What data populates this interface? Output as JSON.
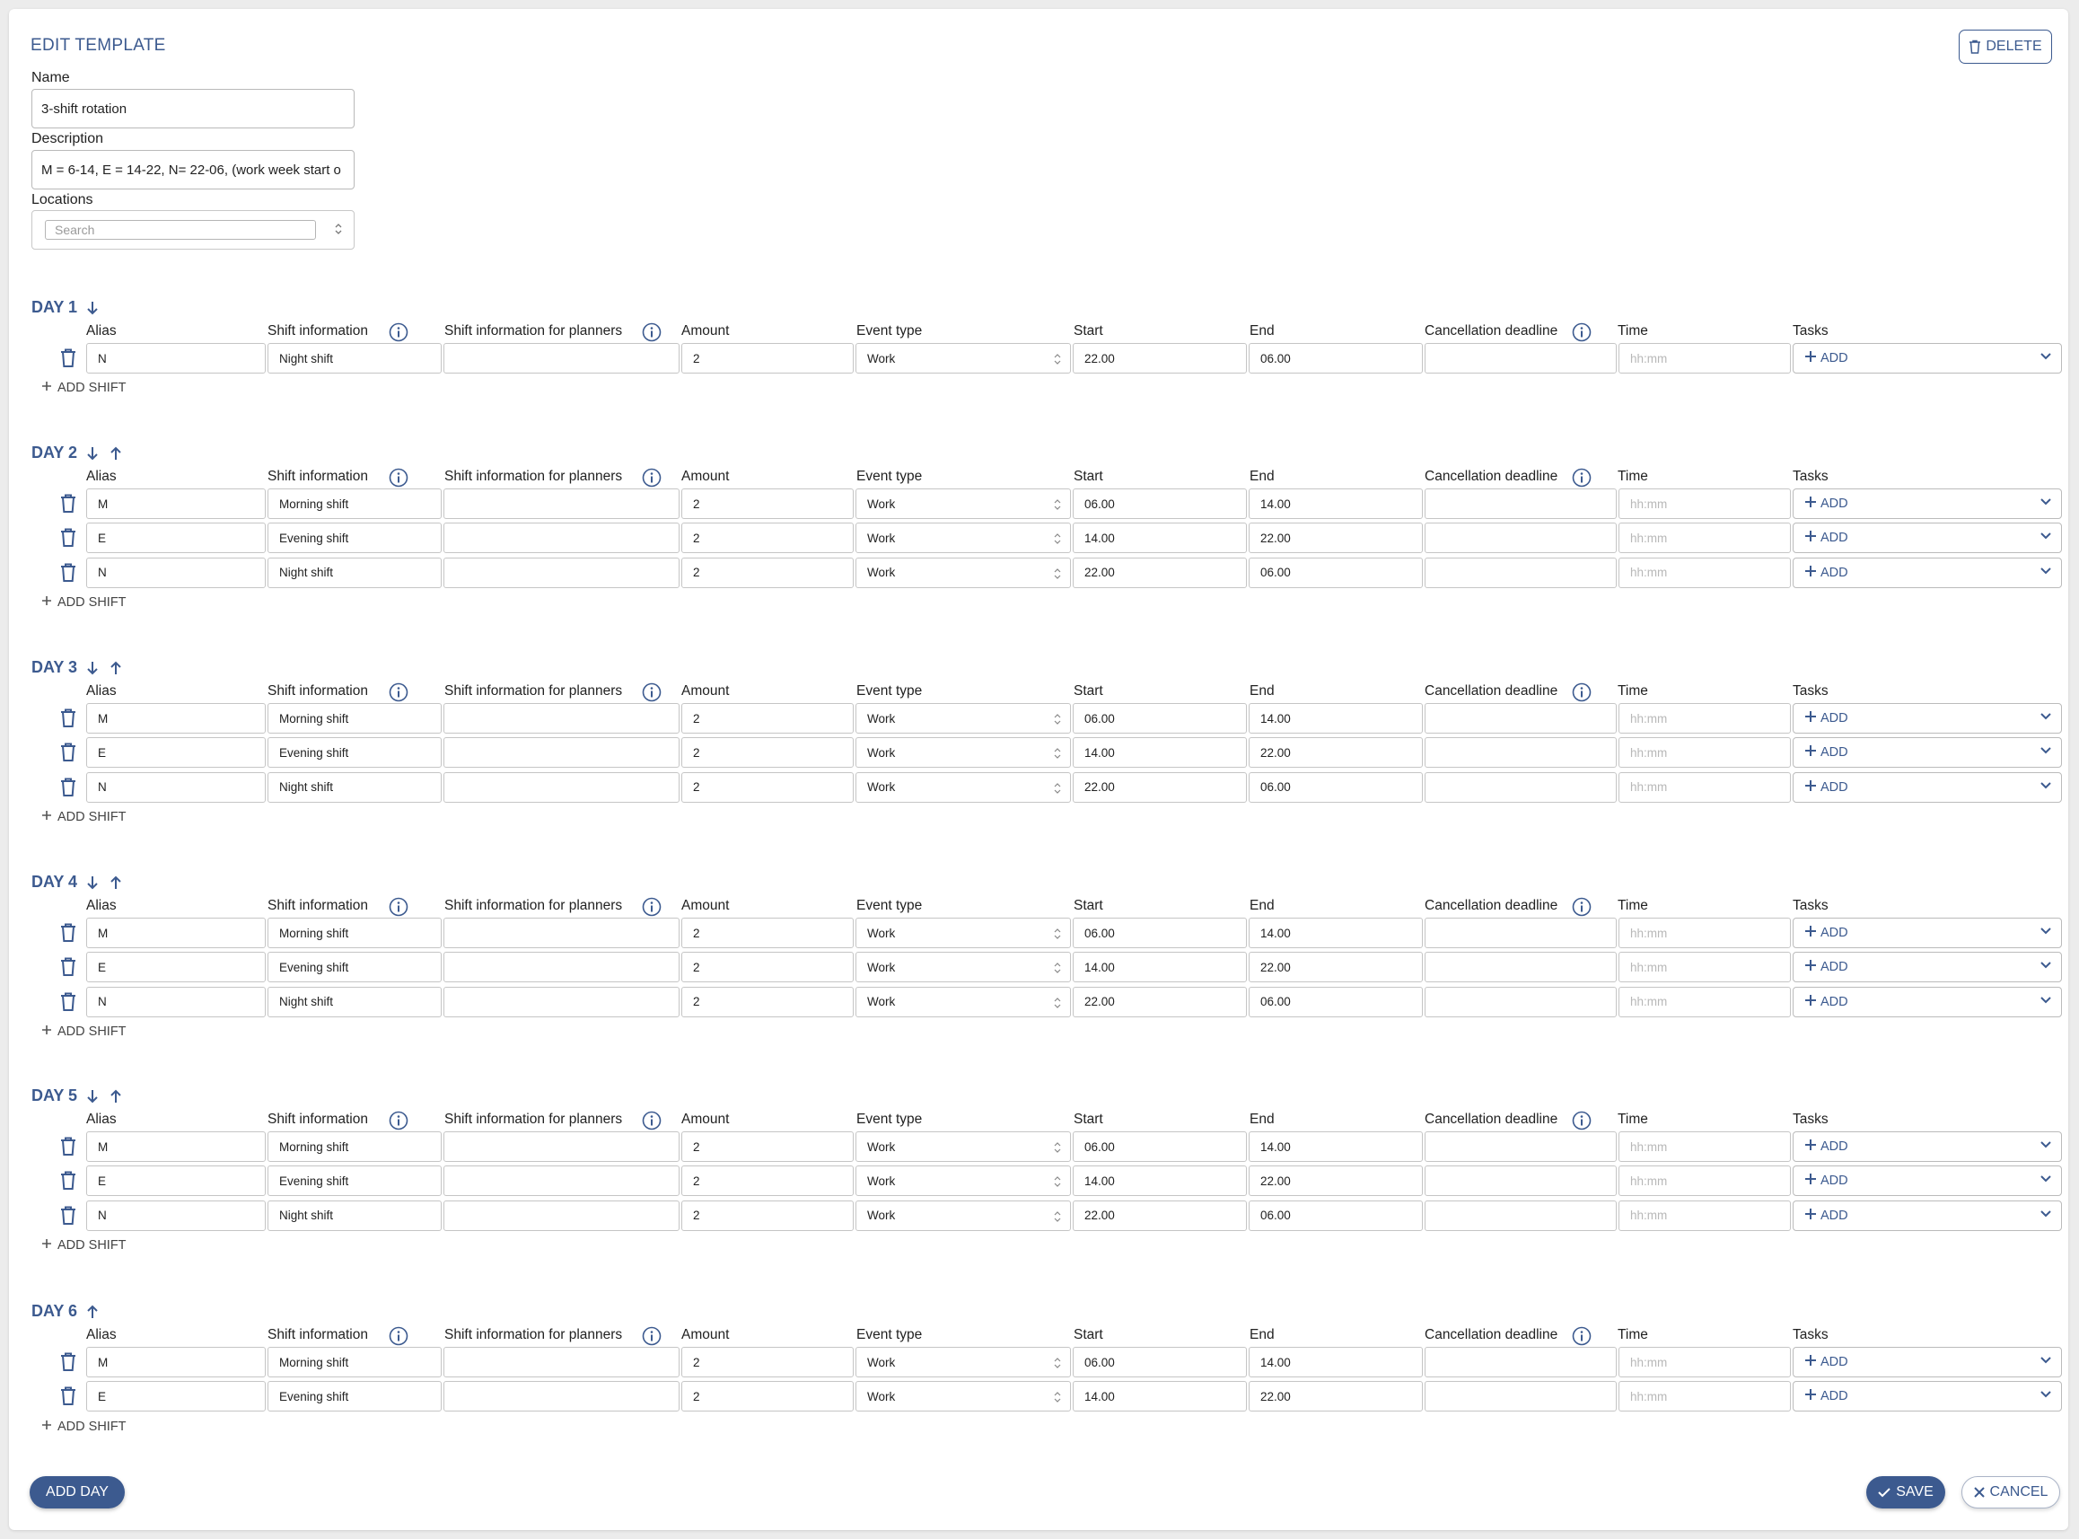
{
  "header": {
    "title": "EDIT TEMPLATE",
    "delete_label": "DELETE"
  },
  "form": {
    "name_label": "Name",
    "name_value": "3-shift rotation",
    "description_label": "Description",
    "description_value": "M = 6-14, E = 14-22, N= 22-06, (work week start o",
    "locations_label": "Locations",
    "locations_placeholder": "Search"
  },
  "columns": {
    "alias": "Alias",
    "shift_info": "Shift information",
    "shift_info_planners": "Shift information for planners",
    "amount": "Amount",
    "event_type": "Event type",
    "start": "Start",
    "end": "End",
    "cancellation": "Cancellation deadline",
    "time": "Time",
    "tasks": "Tasks"
  },
  "time_placeholder": "hh:mm",
  "tasks_add_label": "ADD",
  "add_shift_label": "ADD SHIFT",
  "days": [
    {
      "label": "DAY 1",
      "down": true,
      "up": false,
      "shifts": [
        {
          "alias": "N",
          "info": "Night shift",
          "planners": "",
          "amount": "2",
          "event_type": "Work",
          "start": "22.00",
          "end": "06.00",
          "cancellation": ""
        }
      ]
    },
    {
      "label": "DAY 2",
      "down": true,
      "up": true,
      "shifts": [
        {
          "alias": "M",
          "info": "Morning shift",
          "planners": "",
          "amount": "2",
          "event_type": "Work",
          "start": "06.00",
          "end": "14.00",
          "cancellation": ""
        },
        {
          "alias": "E",
          "info": "Evening shift",
          "planners": "",
          "amount": "2",
          "event_type": "Work",
          "start": "14.00",
          "end": "22.00",
          "cancellation": ""
        },
        {
          "alias": "N",
          "info": "Night shift",
          "planners": "",
          "amount": "2",
          "event_type": "Work",
          "start": "22.00",
          "end": "06.00",
          "cancellation": ""
        }
      ]
    },
    {
      "label": "DAY 3",
      "down": true,
      "up": true,
      "shifts": [
        {
          "alias": "M",
          "info": "Morning shift",
          "planners": "",
          "amount": "2",
          "event_type": "Work",
          "start": "06.00",
          "end": "14.00",
          "cancellation": ""
        },
        {
          "alias": "E",
          "info": "Evening shift",
          "planners": "",
          "amount": "2",
          "event_type": "Work",
          "start": "14.00",
          "end": "22.00",
          "cancellation": ""
        },
        {
          "alias": "N",
          "info": "Night shift",
          "planners": "",
          "amount": "2",
          "event_type": "Work",
          "start": "22.00",
          "end": "06.00",
          "cancellation": ""
        }
      ]
    },
    {
      "label": "DAY 4",
      "down": true,
      "up": true,
      "shifts": [
        {
          "alias": "M",
          "info": "Morning shift",
          "planners": "",
          "amount": "2",
          "event_type": "Work",
          "start": "06.00",
          "end": "14.00",
          "cancellation": ""
        },
        {
          "alias": "E",
          "info": "Evening shift",
          "planners": "",
          "amount": "2",
          "event_type": "Work",
          "start": "14.00",
          "end": "22.00",
          "cancellation": ""
        },
        {
          "alias": "N",
          "info": "Night shift",
          "planners": "",
          "amount": "2",
          "event_type": "Work",
          "start": "22.00",
          "end": "06.00",
          "cancellation": ""
        }
      ]
    },
    {
      "label": "DAY 5",
      "down": true,
      "up": true,
      "shifts": [
        {
          "alias": "M",
          "info": "Morning shift",
          "planners": "",
          "amount": "2",
          "event_type": "Work",
          "start": "06.00",
          "end": "14.00",
          "cancellation": ""
        },
        {
          "alias": "E",
          "info": "Evening shift",
          "planners": "",
          "amount": "2",
          "event_type": "Work",
          "start": "14.00",
          "end": "22.00",
          "cancellation": ""
        },
        {
          "alias": "N",
          "info": "Night shift",
          "planners": "",
          "amount": "2",
          "event_type": "Work",
          "start": "22.00",
          "end": "06.00",
          "cancellation": ""
        }
      ]
    },
    {
      "label": "DAY 6",
      "down": false,
      "up": true,
      "shifts": [
        {
          "alias": "M",
          "info": "Morning shift",
          "planners": "",
          "amount": "2",
          "event_type": "Work",
          "start": "06.00",
          "end": "14.00",
          "cancellation": ""
        },
        {
          "alias": "E",
          "info": "Evening shift",
          "planners": "",
          "amount": "2",
          "event_type": "Work",
          "start": "14.00",
          "end": "22.00",
          "cancellation": ""
        }
      ]
    }
  ],
  "footer": {
    "add_day_label": "ADD DAY",
    "save_label": "SAVE",
    "cancel_label": "CANCEL"
  },
  "colors": {
    "accent": "#3c5a8f"
  }
}
